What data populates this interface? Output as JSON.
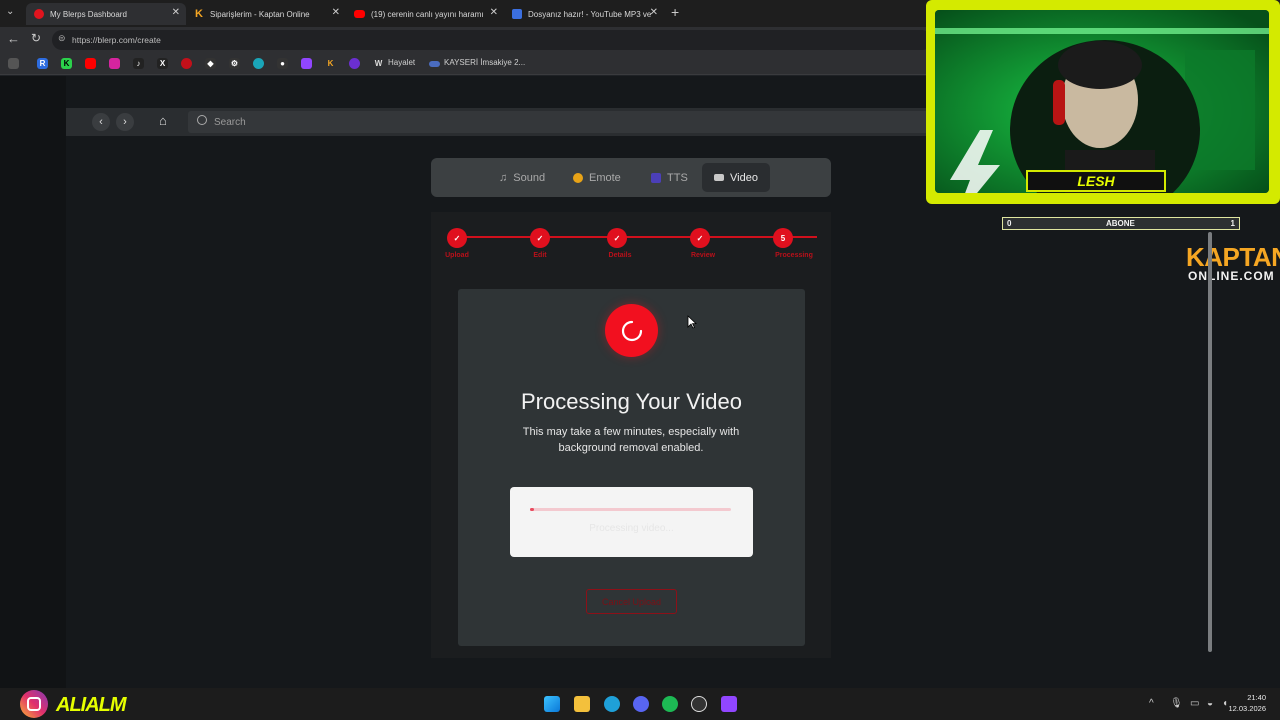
{
  "browser": {
    "tabs": [
      {
        "title": "My Blerps Dashboard",
        "active": true,
        "favicon_color": "#e1141e"
      },
      {
        "title": "Siparişlerim - Kaptan Online",
        "active": false,
        "favicon_color": "#f5a623",
        "favicon_char": "K"
      },
      {
        "title": "(19) cerenin canlı yayını haramı",
        "active": false,
        "favicon_color": "#ff0000"
      },
      {
        "title": "Dosyanız hazır! - YouTube MP3 ve",
        "active": false,
        "favicon_color": "#3b6fe0"
      }
    ],
    "url": "https://blerp.com/create",
    "bookmarks": [
      "Hayalet",
      "KAYSERİ İmsakiye 2..."
    ]
  },
  "app": {
    "search_placeholder": "Search"
  },
  "type_tabs": [
    {
      "label": "Sound",
      "icon": "music-note-icon",
      "selected": false
    },
    {
      "label": "Emote",
      "icon": "emote-icon",
      "selected": false
    },
    {
      "label": "TTS",
      "icon": "tts-icon",
      "selected": false
    },
    {
      "label": "Video",
      "icon": "video-icon",
      "selected": true
    }
  ],
  "steps": [
    {
      "label": "Upload",
      "done": true
    },
    {
      "label": "Edit",
      "done": true
    },
    {
      "label": "Details",
      "done": true
    },
    {
      "label": "Review",
      "done": true
    },
    {
      "label": "Processing",
      "number": "5",
      "done": false
    }
  ],
  "processing": {
    "title": "Processing Your Video",
    "description": "This may take a few minutes, especially with background removal enabled.",
    "progress": 0.0,
    "progress_text": "Processing video...",
    "cancel_label": "Cancel Upload"
  },
  "overlay": {
    "streamer_name": "LESH",
    "subscriber_label": "ABONE",
    "subscriber_current": "0",
    "subscriber_goal": "1",
    "sponsor_top": "KAPTAN",
    "sponsor_bottom": "ONLINE.COM",
    "instagram_handle": "ALIALM"
  },
  "clock": {
    "time": "21:40",
    "date": "12.03.2026"
  },
  "colors": {
    "accent": "#e1101e",
    "overlay_yellow": "#d4ea00"
  }
}
